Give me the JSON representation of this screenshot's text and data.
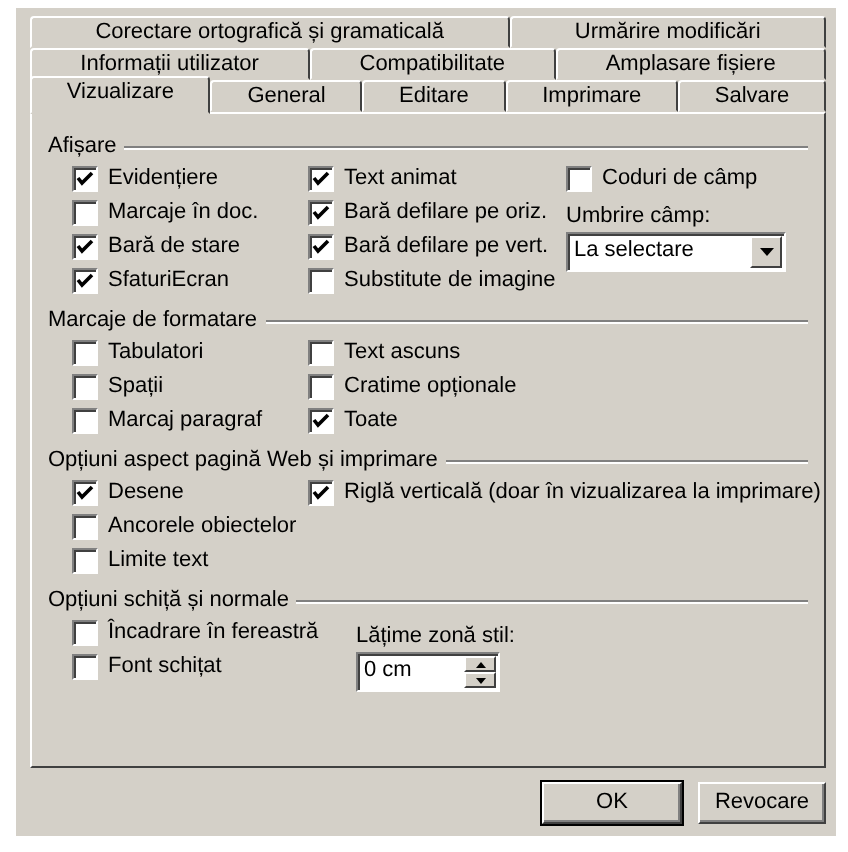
{
  "tab_rows": [
    [
      {
        "label": "Corectare ortografică și gramaticală",
        "selected": false
      },
      {
        "label": "Urmărire modificări",
        "selected": false
      }
    ],
    [
      {
        "label": "Informații utilizator",
        "selected": false
      },
      {
        "label": "Compatibilitate",
        "selected": false
      },
      {
        "label": "Amplasare fișiere",
        "selected": false
      }
    ],
    [
      {
        "label": "Vizualizare",
        "selected": true
      },
      {
        "label": "General",
        "selected": false
      },
      {
        "label": "Editare",
        "selected": false
      },
      {
        "label": "Imprimare",
        "selected": false
      },
      {
        "label": "Salvare",
        "selected": false
      }
    ]
  ],
  "sections": [
    {
      "title": "Afișare",
      "columns": [
        [
          {
            "kind": "checkbox",
            "label": "Evidențiere",
            "checked": true
          },
          {
            "kind": "checkbox",
            "label": "Marcaje în doc.",
            "checked": false
          },
          {
            "kind": "checkbox",
            "label": "Bară de stare",
            "checked": true
          },
          {
            "kind": "checkbox",
            "label": "SfaturiEcran",
            "checked": true
          }
        ],
        [
          {
            "kind": "checkbox",
            "label": "Text animat",
            "checked": true
          },
          {
            "kind": "checkbox",
            "label": "Bară defilare pe oriz.",
            "checked": true
          },
          {
            "kind": "checkbox",
            "label": "Bară defilare pe vert.",
            "checked": true
          },
          {
            "kind": "checkbox",
            "label": "Substitute de imagine",
            "checked": false
          }
        ],
        [
          {
            "kind": "checkbox",
            "label": "Coduri de câmp",
            "checked": false
          },
          {
            "kind": "label",
            "label": "Umbrire câmp:"
          },
          {
            "kind": "dropdown",
            "value": "La selectare"
          }
        ]
      ]
    },
    {
      "title": "Marcaje de formatare",
      "columns": [
        [
          {
            "kind": "checkbox",
            "label": "Tabulatori",
            "checked": false
          },
          {
            "kind": "checkbox",
            "label": "Spații",
            "checked": false
          },
          {
            "kind": "checkbox",
            "label": "Marcaj paragraf",
            "checked": false
          }
        ],
        [
          {
            "kind": "checkbox",
            "label": "Text ascuns",
            "checked": false
          },
          {
            "kind": "checkbox",
            "label": "Cratime opționale",
            "checked": false
          },
          {
            "kind": "checkbox",
            "label": "Toate",
            "checked": true
          }
        ]
      ]
    },
    {
      "title": "Opțiuni aspect pagină Web și imprimare",
      "columns": [
        [
          {
            "kind": "checkbox",
            "label": "Desene",
            "checked": true
          },
          {
            "kind": "checkbox",
            "label": "Ancorele obiectelor",
            "checked": false
          },
          {
            "kind": "checkbox",
            "label": "Limite text",
            "checked": false
          }
        ],
        [
          {
            "kind": "checkbox",
            "label": "Riglă verticală (doar în vizualizarea la imprimare)",
            "checked": true
          }
        ]
      ]
    },
    {
      "title": "Opțiuni schiță și normale",
      "columns": [
        [
          {
            "kind": "checkbox",
            "label": "Încadrare în fereastră",
            "checked": false
          },
          {
            "kind": "checkbox",
            "label": "Font schițat",
            "checked": false
          }
        ],
        [
          {
            "kind": "label",
            "label": "Lățime zonă stil:"
          },
          {
            "kind": "spinner",
            "value": "0 cm"
          }
        ]
      ]
    }
  ],
  "buttons": [
    "OK",
    "Revocare"
  ]
}
